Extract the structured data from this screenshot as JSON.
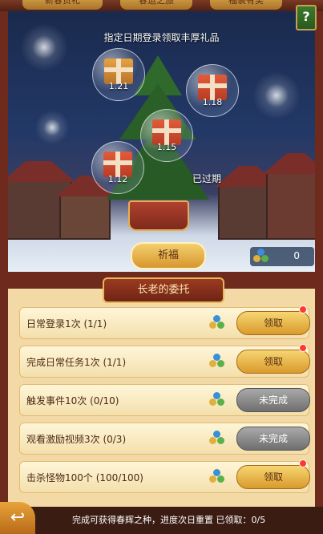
{
  "tabs": [
    "新春贺礼",
    "春运之旅",
    "福袋有奖"
  ],
  "help": "?",
  "banner": "指定日期登录领取丰厚礼品",
  "gifts": [
    {
      "date": "1.21"
    },
    {
      "date": "1.18"
    },
    {
      "date": "1.15"
    },
    {
      "date": "1.12"
    }
  ],
  "expired_label": "已过期",
  "pray_button": "祈福",
  "seed_count": "0",
  "panel_title": "长老的委托",
  "tasks": [
    {
      "label": "日常登录1次  (1/1)",
      "button": "领取",
      "state": "claim"
    },
    {
      "label": "完成日常任务1次  (1/1)",
      "button": "领取",
      "state": "claim"
    },
    {
      "label": "触发事件10次  (0/10)",
      "button": "未完成",
      "state": "incomplete"
    },
    {
      "label": "观看激励视频3次  (0/3)",
      "button": "未完成",
      "state": "incomplete"
    },
    {
      "label": "击杀怪物100个  (100/100)",
      "button": "领取",
      "state": "claim"
    }
  ],
  "footer": "完成可获得春辉之种，进度次日重置  已领取：0/5",
  "colors": {
    "claim": "#f0c050",
    "incomplete": "#8a8a8a",
    "panel": "#f3d9a6"
  }
}
